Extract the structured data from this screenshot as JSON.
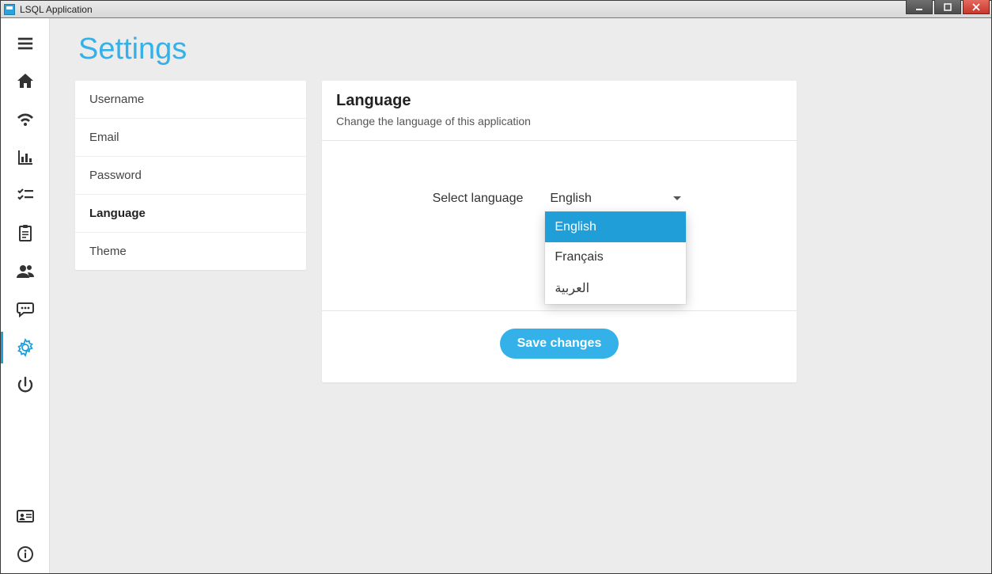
{
  "window": {
    "title": "LSQL Application"
  },
  "sidebar": {
    "items": [
      {
        "name": "menu-icon"
      },
      {
        "name": "home-icon"
      },
      {
        "name": "wifi-icon"
      },
      {
        "name": "bar-chart-icon"
      },
      {
        "name": "checklist-icon"
      },
      {
        "name": "clipboard-icon"
      },
      {
        "name": "users-icon"
      },
      {
        "name": "chat-icon"
      },
      {
        "name": "gear-icon",
        "active": true
      },
      {
        "name": "power-icon"
      }
    ],
    "bottom": [
      {
        "name": "id-card-icon"
      },
      {
        "name": "info-icon"
      }
    ]
  },
  "page": {
    "title": "Settings"
  },
  "settings_nav": {
    "items": [
      {
        "label": "Username"
      },
      {
        "label": "Email"
      },
      {
        "label": "Password"
      },
      {
        "label": "Language",
        "active": true
      },
      {
        "label": "Theme"
      }
    ]
  },
  "panel": {
    "heading": "Language",
    "subtitle": "Change the language of this application",
    "form_label": "Select language",
    "selected": "English",
    "options": [
      {
        "label": "English",
        "selected": true
      },
      {
        "label": "Français"
      },
      {
        "label": "العربية"
      }
    ],
    "save_label": "Save changes"
  },
  "colors": {
    "accent": "#33b1e8",
    "accent_dark": "#1f9ed8"
  }
}
